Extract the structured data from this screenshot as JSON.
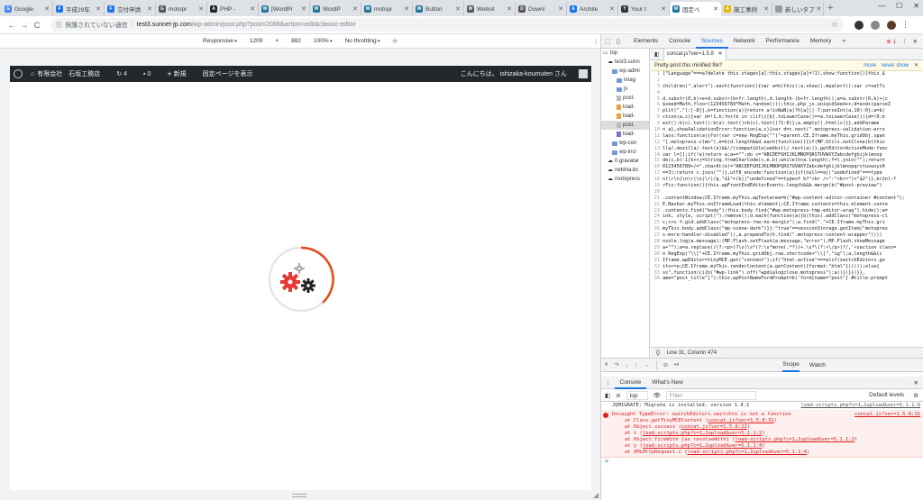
{
  "browser": {
    "tabs": [
      {
        "title": "Google",
        "color": "#4285f4",
        "icon_letter": "G"
      },
      {
        "title": "平成29年",
        "color": "#1a73e8",
        "icon_letter": "F"
      },
      {
        "title": "交付申請",
        "color": "#1a73e8",
        "icon_letter": "F"
      },
      {
        "title": "motopr",
        "color": "#555",
        "icon_letter": "G"
      },
      {
        "title": "PHP -",
        "color": "#222",
        "icon_letter": "A"
      },
      {
        "title": "[WordPr",
        "color": "#21759b",
        "icon_letter": "W"
      },
      {
        "title": "WordP",
        "color": "#21759b",
        "icon_letter": "W"
      },
      {
        "title": "motopr",
        "color": "#21759b",
        "icon_letter": "W"
      },
      {
        "title": "Button",
        "color": "#21759b",
        "icon_letter": "W"
      },
      {
        "title": "Websit",
        "color": "#555",
        "icon_letter": "W"
      },
      {
        "title": "Downl",
        "color": "#555",
        "icon_letter": "D"
      },
      {
        "title": "Archite",
        "color": "#1a73e8",
        "icon_letter": "A"
      },
      {
        "title": "Your t",
        "color": "#333",
        "icon_letter": "Y"
      },
      {
        "title": "固定ペ",
        "color": "#21759b",
        "icon_letter": "W",
        "active": true
      },
      {
        "title": "施工事例",
        "color": "#e8b400",
        "icon_letter": "A"
      },
      {
        "title": "新しいタブ",
        "color": "#999",
        "icon_letter": " "
      }
    ],
    "new_tab": "+",
    "window_controls": [
      "—",
      "☐",
      "✕"
    ],
    "nav": {
      "back": "←",
      "forward": "→",
      "reload": "C"
    },
    "address": {
      "insecure_label": "保護されていない通信",
      "domain": "test3.sunnet-jp.com",
      "path": "/wp-admin/post.php?post=2086&action=edit&classic-editor"
    },
    "star": "☆"
  },
  "device_toolbar": {
    "device": "Responsive",
    "width": "1209",
    "height": "882",
    "zoom": "100%",
    "throttle": "No throttling"
  },
  "wp_adminbar": {
    "site_name": "有限会社　石坂工務店",
    "updates": "4",
    "comments": "0",
    "new_label": "新規",
    "view_label": "固定ページを表示",
    "greeting": "こんにちは、 ishizaka-koumuten さん"
  },
  "devtools": {
    "tabs": [
      "Elements",
      "Console",
      "Sources",
      "Network",
      "Performance",
      "Memory"
    ],
    "active_tab": "Sources",
    "more_tabs": "»",
    "error_count": "1",
    "navigator": [
      {
        "label": "top",
        "kind": "top",
        "indent": 0
      },
      {
        "label": "test3.sunn",
        "kind": "cloud",
        "indent": 1
      },
      {
        "label": "wp-admi",
        "kind": "folder",
        "indent": 2
      },
      {
        "label": "imag",
        "kind": "folder",
        "indent": 3
      },
      {
        "label": "js",
        "kind": "folder",
        "indent": 3
      },
      {
        "label": "post.",
        "kind": "file",
        "indent": 3
      },
      {
        "label": "load-",
        "kind": "js",
        "indent": 3
      },
      {
        "label": "load-",
        "kind": "js",
        "indent": 3
      },
      {
        "label": "post.",
        "kind": "file",
        "indent": 3,
        "selected": true
      },
      {
        "label": "load-",
        "kind": "sel",
        "indent": 3
      },
      {
        "label": "wp-con",
        "kind": "folder",
        "indent": 2
      },
      {
        "label": "wp-incl",
        "kind": "folder",
        "indent": 2
      },
      {
        "label": "0.gravatar",
        "kind": "cloud",
        "indent": 1
      },
      {
        "label": "netdna.bc",
        "kind": "cloud",
        "indent": 1
      },
      {
        "label": "motopress",
        "kind": "cloud",
        "indent": 1
      }
    ],
    "file_tab": "concat.js?ver=1.5.8",
    "pretty_print": "Pretty-print this minified file?",
    "pretty_more": "more",
    "pretty_never": "never show",
    "code_lines": [
      {
        "n": "1",
        "t": "[\"Language\"===a?delete this.stages[a]:this.stages[a]=!1),show:function(){this.$"
      },
      {
        "n": "2",
        "t": ""
      },
      {
        "n": "3",
        "t": "children(\".alert\").each(function(){var a=b(this);a.show().mpalert();var c=setTi"
      },
      {
        "n": "4",
        "t": ""
      },
      {
        "n": "5",
        "t": "d.substr(0,b)+e+d.substr(b+fr.length),d.length-(b+fr.length));a=a.substr(0,b)+(c"
      },
      {
        "n": "6",
        "t": "$seed=Math.floor(123456789*Math.random()));this.php_js.uniqidSeed++;d=a+d+(parseI"
      },
      {
        "n": "7",
        "t": "plit(\".\"):[-8]},k=function(a){return a!isNaN(a)?h[a]||-7:parseInt(a,10):0};a=b("
      },
      {
        "n": "8",
        "t": "ction(a,c){var d=!1,b;for(b in c)if(c[b].toLowerCase()==a.toLowerCase()){d=!0;b"
      },
      {
        "n": "9",
        "t": "ext():b(c).text():b(a).text()>b(c).text()?1:0)};a.empty().html(c)}},addParame"
      },
      {
        "n": "10",
        "t": "n a},showValidationError:function(a,c){var d=c.next(\".motopress-validation-erro"
      },
      {
        "n": "11",
        "t": "lass:function(a){for(var c=new RegExp(\"^(\"+parent.CE.Iframe.myThis.gridObj.span"
      },
      {
        "n": "12",
        "t": "\"].motopress-clmn\"),e=b(d.length&&d.each(function(){if(MP.Utils.notClone(b(this"
      },
      {
        "n": "13",
        "t": "lla/,mozilla/.test(a)&&!/(compatible|webkit)/.test(a))},getEditorActiveMode:func"
      },
      {
        "n": "14",
        "t": "var l=[];if(!a)return a;a+=\"\";do c=\"ABCDEFGHIJKLMNOPQRSTUVWXYZabcdefghijklmnop"
      },
      {
        "n": "15",
        "t": "de(c,b):1[k++]=String.fromCharCode(c,e,b);while(h<a.length);f=l.join(\"\");return"
      },
      {
        "n": "16",
        "t": "0123456789+/=\".charAt(e)=\"ABCDEFGHIJKLMNOPQRSTUVWXYZabcdefghijklmnopqrstuvwxyz0"
      },
      {
        "n": "17",
        "t": "==3);return c.join(\"\")},utf8_encode:function(a){if(null==a||\"undefined\"===type"
      },
      {
        "n": "18",
        "t": "n(\\r\\n|\\n\\r|\\n|\\r)/g,\"$1\"+(b||\"undefined\"==typeof b?\"<br />\":\"<br>\")+\"$2\")},br2nl:f"
      },
      {
        "n": "19",
        "t": "rFix:function(){this.wpFrontEndEditorEvents.length&&b.merge(b(\"#post-preview\")"
      },
      {
        "n": "20",
        "t": ""
      },
      {
        "n": "21",
        "t": ".contentWindow;CE.Iframe.myThis.wpTextarea=b(\"#wp-content-editor-container #content\");"
      },
      {
        "n": "22",
        "t": "E.Navbar.myThis.onIframeLoad(this.element);CE.Iframe.contents=this.element.conte"
      },
      {
        "n": "23",
        "t": ".contents.find(\"body\");this.body.find(\"#wp-motopress-tmp-editor-wrap\").hide();a="
      },
      {
        "n": "24",
        "t": "ink, style, script)\").remove();d.each(function(a){b(this).addClass(\"motopress-cl"
      },
      {
        "n": "25",
        "t": "c;c+c-f.gid.addClass(\"motopress-row-no-margin\");a.find(\".\"+CE.Iframe.myThis.gri"
      },
      {
        "n": "26",
        "t": "myThis.body.addClass(\"mp-scene-dark\")}}:\"true\"==sessionStorage.getItem(\"motopres"
      },
      {
        "n": "27",
        "t": "s-more-handler-disabled\")),a.prependTo(h.find(\".motopress-content-wrapper\"))))"
      },
      {
        "n": "28",
        "t": "nsole.log(a.message);(MP.Flash.setFlash(a.message,\"error\"),MP.Flash.showMessage"
      },
      {
        "n": "29",
        "t": "a+\"\");a=a.replace(/(?:<p>)?\\s(\\s*(?:\\s*more(.*?))+.\\s*\\(?:<\\/p>)?/,'<section class="
      },
      {
        "n": "30",
        "t": "n RegExp(\"\\\\[\"+CE.Iframe.myThis.gridObj.row.shortcode+\"\\\\]\",\"ig\");a.length&&(c"
      },
      {
        "n": "31",
        "t": "Iframe.wpEditor=tinyMCE.get(\"content\");if(\"html-active\"===a)if(switchEditors.go"
      },
      {
        "n": "32",
        "t": "itor=a;CE.Iframe.myThis.renderContent(a.getContent({format:\"html\"})))));else{"
      },
      {
        "n": "33",
        "t": "ss\",function(c){b(\"#wp-link\").off(\"wpdialogclose.motopress\");a()})}})}},"
      },
      {
        "n": "34",
        "t": "ame=\"post_title\"]\");this.wpPostNameFormPrompt=b('form[name=\"post\"] #title-prompt"
      }
    ],
    "cursor_status": "Line 31, Column 474",
    "debugger_tabs": [
      "Scope",
      "Watch"
    ],
    "active_debug_tab": "Scope",
    "drawer_tabs": [
      "Console",
      "What's New"
    ],
    "active_drawer_tab": "Console",
    "console_context": "top",
    "console_filter_placeholder": "Filter",
    "console_levels": "Default levels",
    "console_messages": [
      {
        "type": "log",
        "text": "JQMIGRATE: Migrate is installed, version 1.4.1",
        "source": "load-scripts.php?c=1…1upload&ver=5.1.1:8"
      },
      {
        "type": "error",
        "text": "Uncaught TypeError: switchEditors.switchto is not a function",
        "source": "concat.js?ver=1.5.8:31",
        "stack": [
          {
            "pre": "at Class.getTinyMCEContent (",
            "link": "concat.js?ver=1.5.8:31",
            "post": ")"
          },
          {
            "pre": "at Object.success (",
            "link": "concat.js?ver=1.5.8:22",
            "post": ")"
          },
          {
            "pre": "at i (",
            "link": "load-scripts.php?c=1…1upload&ver=5.1.1:2",
            "post": ")"
          },
          {
            "pre": "at Object.fireWith [as resolveWith] (",
            "link": "load-scripts.php?c=1…1upload&ver=5.1.1:2",
            "post": ")"
          },
          {
            "pre": "at y (",
            "link": "load-scripts.php?c=1…1upload&ver=5.1.1:4",
            "post": ")"
          },
          {
            "pre": "at XMLHttpRequest.c (",
            "link": "load-scripts.php?c=1…1upload&ver=5.1.1:4",
            "post": ")"
          }
        ]
      }
    ],
    "prompt": ">"
  }
}
